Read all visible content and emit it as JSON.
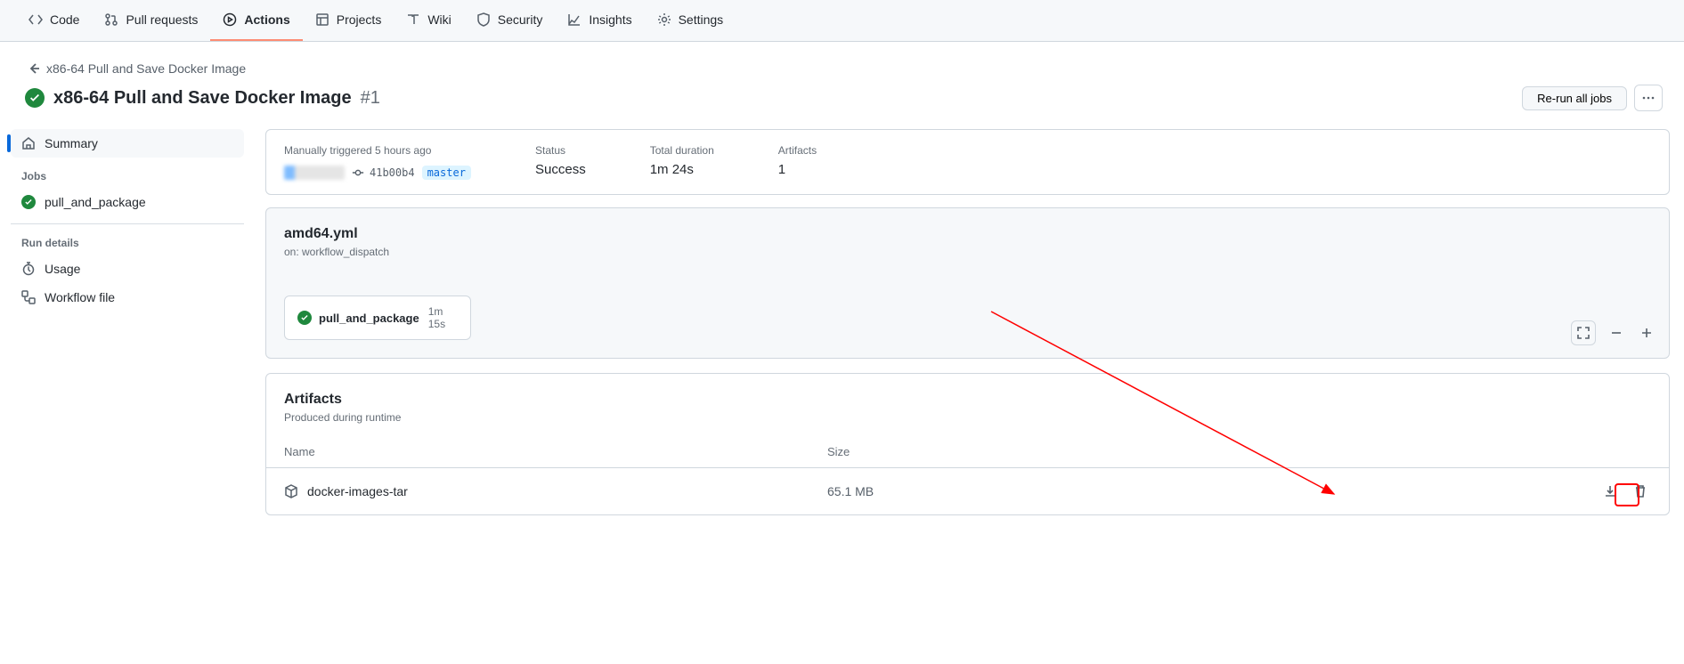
{
  "tabs": {
    "code": "Code",
    "pulls": "Pull requests",
    "actions": "Actions",
    "projects": "Projects",
    "wiki": "Wiki",
    "security": "Security",
    "insights": "Insights",
    "settings": "Settings"
  },
  "breadcrumb": {
    "parent": "x86-64 Pull and Save Docker Image"
  },
  "run": {
    "title": "x86-64 Pull and Save Docker Image",
    "number": "#1",
    "rerun_label": "Re-run all jobs"
  },
  "sidebar": {
    "summary": "Summary",
    "jobs_heading": "Jobs",
    "jobs": [
      {
        "name": "pull_and_package"
      }
    ],
    "run_details_heading": "Run details",
    "usage": "Usage",
    "workflow_file": "Workflow file"
  },
  "meta": {
    "trigger_label": "Manually triggered 5 hours ago",
    "sha": "41b00b4",
    "branch": "master",
    "status_label": "Status",
    "status_value": "Success",
    "duration_label": "Total duration",
    "duration_value": "1m 24s",
    "artifacts_label": "Artifacts",
    "artifacts_value": "1"
  },
  "workflow": {
    "filename": "amd64.yml",
    "trigger_text": "on: workflow_dispatch",
    "job_name": "pull_and_package",
    "job_duration": "1m 15s"
  },
  "artifacts": {
    "title": "Artifacts",
    "subtitle": "Produced during runtime",
    "th_name": "Name",
    "th_size": "Size",
    "rows": [
      {
        "name": "docker-images-tar",
        "size": "65.1 MB"
      }
    ]
  }
}
